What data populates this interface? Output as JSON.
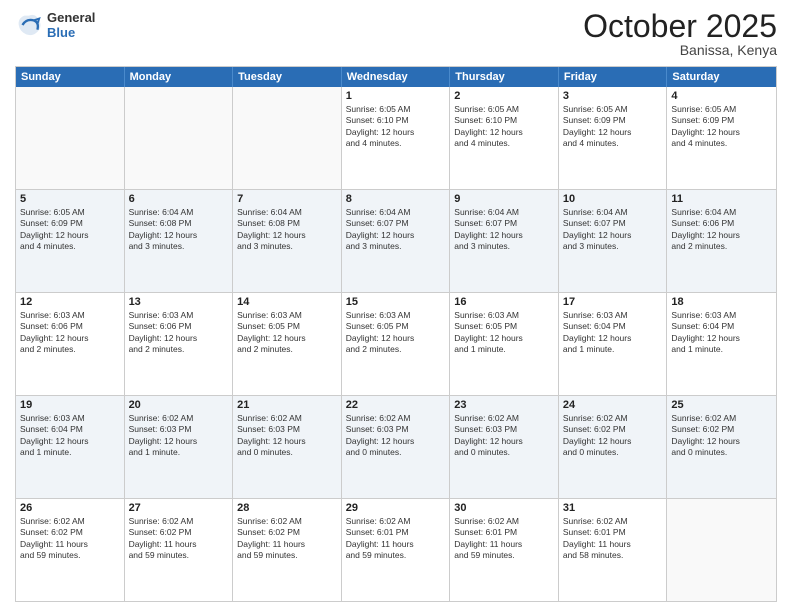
{
  "header": {
    "logo_general": "General",
    "logo_blue": "Blue",
    "month": "October 2025",
    "location": "Banissa, Kenya"
  },
  "weekdays": [
    "Sunday",
    "Monday",
    "Tuesday",
    "Wednesday",
    "Thursday",
    "Friday",
    "Saturday"
  ],
  "rows": [
    {
      "cells": [
        {
          "day": "",
          "text": ""
        },
        {
          "day": "",
          "text": ""
        },
        {
          "day": "",
          "text": ""
        },
        {
          "day": "1",
          "text": "Sunrise: 6:05 AM\nSunset: 6:10 PM\nDaylight: 12 hours\nand 4 minutes."
        },
        {
          "day": "2",
          "text": "Sunrise: 6:05 AM\nSunset: 6:10 PM\nDaylight: 12 hours\nand 4 minutes."
        },
        {
          "day": "3",
          "text": "Sunrise: 6:05 AM\nSunset: 6:09 PM\nDaylight: 12 hours\nand 4 minutes."
        },
        {
          "day": "4",
          "text": "Sunrise: 6:05 AM\nSunset: 6:09 PM\nDaylight: 12 hours\nand 4 minutes."
        }
      ]
    },
    {
      "cells": [
        {
          "day": "5",
          "text": "Sunrise: 6:05 AM\nSunset: 6:09 PM\nDaylight: 12 hours\nand 4 minutes."
        },
        {
          "day": "6",
          "text": "Sunrise: 6:04 AM\nSunset: 6:08 PM\nDaylight: 12 hours\nand 3 minutes."
        },
        {
          "day": "7",
          "text": "Sunrise: 6:04 AM\nSunset: 6:08 PM\nDaylight: 12 hours\nand 3 minutes."
        },
        {
          "day": "8",
          "text": "Sunrise: 6:04 AM\nSunset: 6:07 PM\nDaylight: 12 hours\nand 3 minutes."
        },
        {
          "day": "9",
          "text": "Sunrise: 6:04 AM\nSunset: 6:07 PM\nDaylight: 12 hours\nand 3 minutes."
        },
        {
          "day": "10",
          "text": "Sunrise: 6:04 AM\nSunset: 6:07 PM\nDaylight: 12 hours\nand 3 minutes."
        },
        {
          "day": "11",
          "text": "Sunrise: 6:04 AM\nSunset: 6:06 PM\nDaylight: 12 hours\nand 2 minutes."
        }
      ]
    },
    {
      "cells": [
        {
          "day": "12",
          "text": "Sunrise: 6:03 AM\nSunset: 6:06 PM\nDaylight: 12 hours\nand 2 minutes."
        },
        {
          "day": "13",
          "text": "Sunrise: 6:03 AM\nSunset: 6:06 PM\nDaylight: 12 hours\nand 2 minutes."
        },
        {
          "day": "14",
          "text": "Sunrise: 6:03 AM\nSunset: 6:05 PM\nDaylight: 12 hours\nand 2 minutes."
        },
        {
          "day": "15",
          "text": "Sunrise: 6:03 AM\nSunset: 6:05 PM\nDaylight: 12 hours\nand 2 minutes."
        },
        {
          "day": "16",
          "text": "Sunrise: 6:03 AM\nSunset: 6:05 PM\nDaylight: 12 hours\nand 1 minute."
        },
        {
          "day": "17",
          "text": "Sunrise: 6:03 AM\nSunset: 6:04 PM\nDaylight: 12 hours\nand 1 minute."
        },
        {
          "day": "18",
          "text": "Sunrise: 6:03 AM\nSunset: 6:04 PM\nDaylight: 12 hours\nand 1 minute."
        }
      ]
    },
    {
      "cells": [
        {
          "day": "19",
          "text": "Sunrise: 6:03 AM\nSunset: 6:04 PM\nDaylight: 12 hours\nand 1 minute."
        },
        {
          "day": "20",
          "text": "Sunrise: 6:02 AM\nSunset: 6:03 PM\nDaylight: 12 hours\nand 1 minute."
        },
        {
          "day": "21",
          "text": "Sunrise: 6:02 AM\nSunset: 6:03 PM\nDaylight: 12 hours\nand 0 minutes."
        },
        {
          "day": "22",
          "text": "Sunrise: 6:02 AM\nSunset: 6:03 PM\nDaylight: 12 hours\nand 0 minutes."
        },
        {
          "day": "23",
          "text": "Sunrise: 6:02 AM\nSunset: 6:03 PM\nDaylight: 12 hours\nand 0 minutes."
        },
        {
          "day": "24",
          "text": "Sunrise: 6:02 AM\nSunset: 6:02 PM\nDaylight: 12 hours\nand 0 minutes."
        },
        {
          "day": "25",
          "text": "Sunrise: 6:02 AM\nSunset: 6:02 PM\nDaylight: 12 hours\nand 0 minutes."
        }
      ]
    },
    {
      "cells": [
        {
          "day": "26",
          "text": "Sunrise: 6:02 AM\nSunset: 6:02 PM\nDaylight: 11 hours\nand 59 minutes."
        },
        {
          "day": "27",
          "text": "Sunrise: 6:02 AM\nSunset: 6:02 PM\nDaylight: 11 hours\nand 59 minutes."
        },
        {
          "day": "28",
          "text": "Sunrise: 6:02 AM\nSunset: 6:02 PM\nDaylight: 11 hours\nand 59 minutes."
        },
        {
          "day": "29",
          "text": "Sunrise: 6:02 AM\nSunset: 6:01 PM\nDaylight: 11 hours\nand 59 minutes."
        },
        {
          "day": "30",
          "text": "Sunrise: 6:02 AM\nSunset: 6:01 PM\nDaylight: 11 hours\nand 59 minutes."
        },
        {
          "day": "31",
          "text": "Sunrise: 6:02 AM\nSunset: 6:01 PM\nDaylight: 11 hours\nand 58 minutes."
        },
        {
          "day": "",
          "text": ""
        }
      ]
    }
  ]
}
